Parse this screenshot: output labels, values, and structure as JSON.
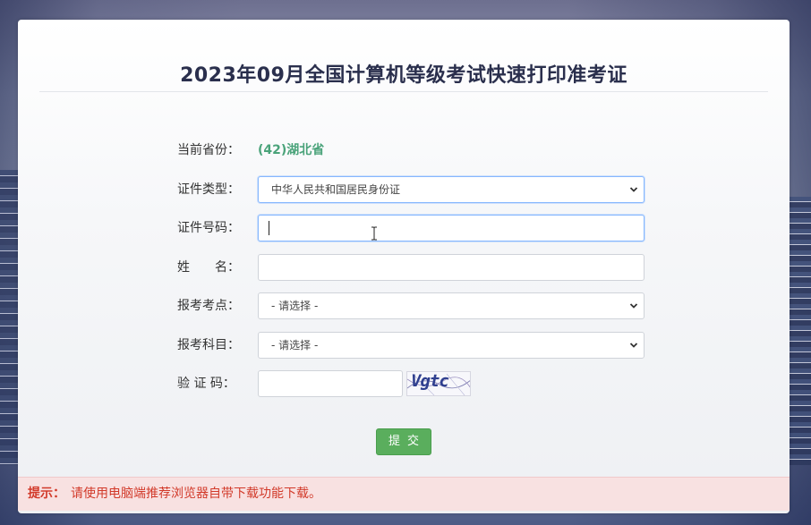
{
  "page": {
    "title": "2023年09月全国计算机等级考试快速打印准考证"
  },
  "form": {
    "province": {
      "label": "当前省份：",
      "value": "(42)湖北省"
    },
    "id_type": {
      "label": "证件类型：",
      "selected": "中华人民共和国居民身份证"
    },
    "id_number": {
      "label": "证件号码：",
      "value": ""
    },
    "name": {
      "label": "姓　　名：",
      "value": ""
    },
    "exam_site": {
      "label": "报考考点：",
      "selected": "- 请选择 -"
    },
    "subject": {
      "label": "报考科目：",
      "selected": "- 请选择 -"
    },
    "captcha": {
      "label": "验 证 码：",
      "value": "",
      "image_text": "Vgtc"
    },
    "submit_label": "提交"
  },
  "tip": {
    "label": "提示：",
    "text": "请使用电脑端推荐浏览器自带下载功能下载。"
  },
  "colors": {
    "accent_green": "#5aae5d",
    "province_green": "#4aa37a",
    "tip_red": "#d23a2a",
    "tip_bg": "#f8e1e1",
    "title": "#2a2f4d"
  },
  "icons": {
    "select_arrow": "chevron-down-icon",
    "text_cursor": "ibeam-cursor-icon"
  }
}
